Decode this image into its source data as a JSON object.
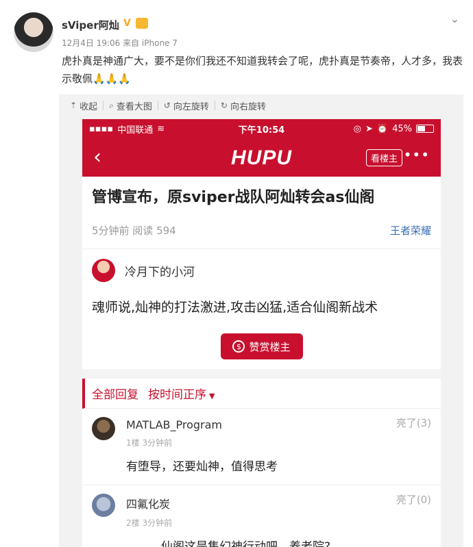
{
  "post": {
    "username": "sViper阿灿",
    "verified_mark": "V",
    "meta": "12月4日 19:06 来自 iPhone 7",
    "content": "虎扑真是神通广大，要不是你们我还不知道我转会了呢，虎扑真是节奏帝，人才多，我表示敬佩",
    "emoji": "🙏🙏🙏"
  },
  "toolbar": {
    "collapse": "收起",
    "view_large": "查看大图",
    "rotate_left": "向左旋转",
    "rotate_right": "向右旋转"
  },
  "phone": {
    "carrier": "中国联通",
    "time": "下午10:54",
    "battery": "45%",
    "logo": "HUPU",
    "louzhu": "看楼主",
    "title": "管博宣布，原sviper战队阿灿转会as仙阁",
    "stats": {
      "time_read": "5分钟前 阅读 594",
      "category": "王者荣耀"
    },
    "author": "冷月下的小河",
    "body": "魂师说,灿神的打法激进,攻击凶猛,适合仙阁新战术",
    "tip_button": "赞赏楼主",
    "sort": {
      "all_replies": "全部回复",
      "order": "按时间正序"
    },
    "replies": [
      {
        "name": "MATLAB_Program",
        "meta": "1楼 3分钟前",
        "text": "有堕导，还要灿神，值得思考",
        "light": "亮了(3)"
      },
      {
        "name": "四氟化炭",
        "meta": "2楼 3分钟前",
        "text": "。。。。。仙阁这是集幻神行动吧，养老院?",
        "light": "亮了(0)"
      }
    ]
  }
}
